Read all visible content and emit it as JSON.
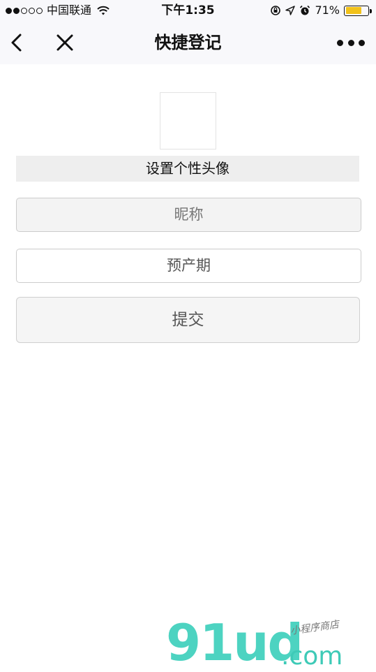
{
  "status_bar": {
    "carrier": "中国联通",
    "time": "下午1:35",
    "battery_percent": "71%",
    "battery_level": 0.71,
    "signal_bars_filled": 2,
    "signal_bars_total": 5,
    "battery_color": "#f2c21a"
  },
  "nav": {
    "title": "快捷登记",
    "back_icon": "chevron-left-icon",
    "close_icon": "close-icon",
    "more_icon": "more-dots-icon"
  },
  "form": {
    "avatar_label": "设置个性头像",
    "nickname_placeholder": "昵称",
    "due_date_placeholder": "预产期",
    "submit_label": "提交"
  },
  "watermark": {
    "brand": "91ud",
    "suffix": ".com",
    "tagline": "小程序商店",
    "color": "#4dd3c1"
  }
}
